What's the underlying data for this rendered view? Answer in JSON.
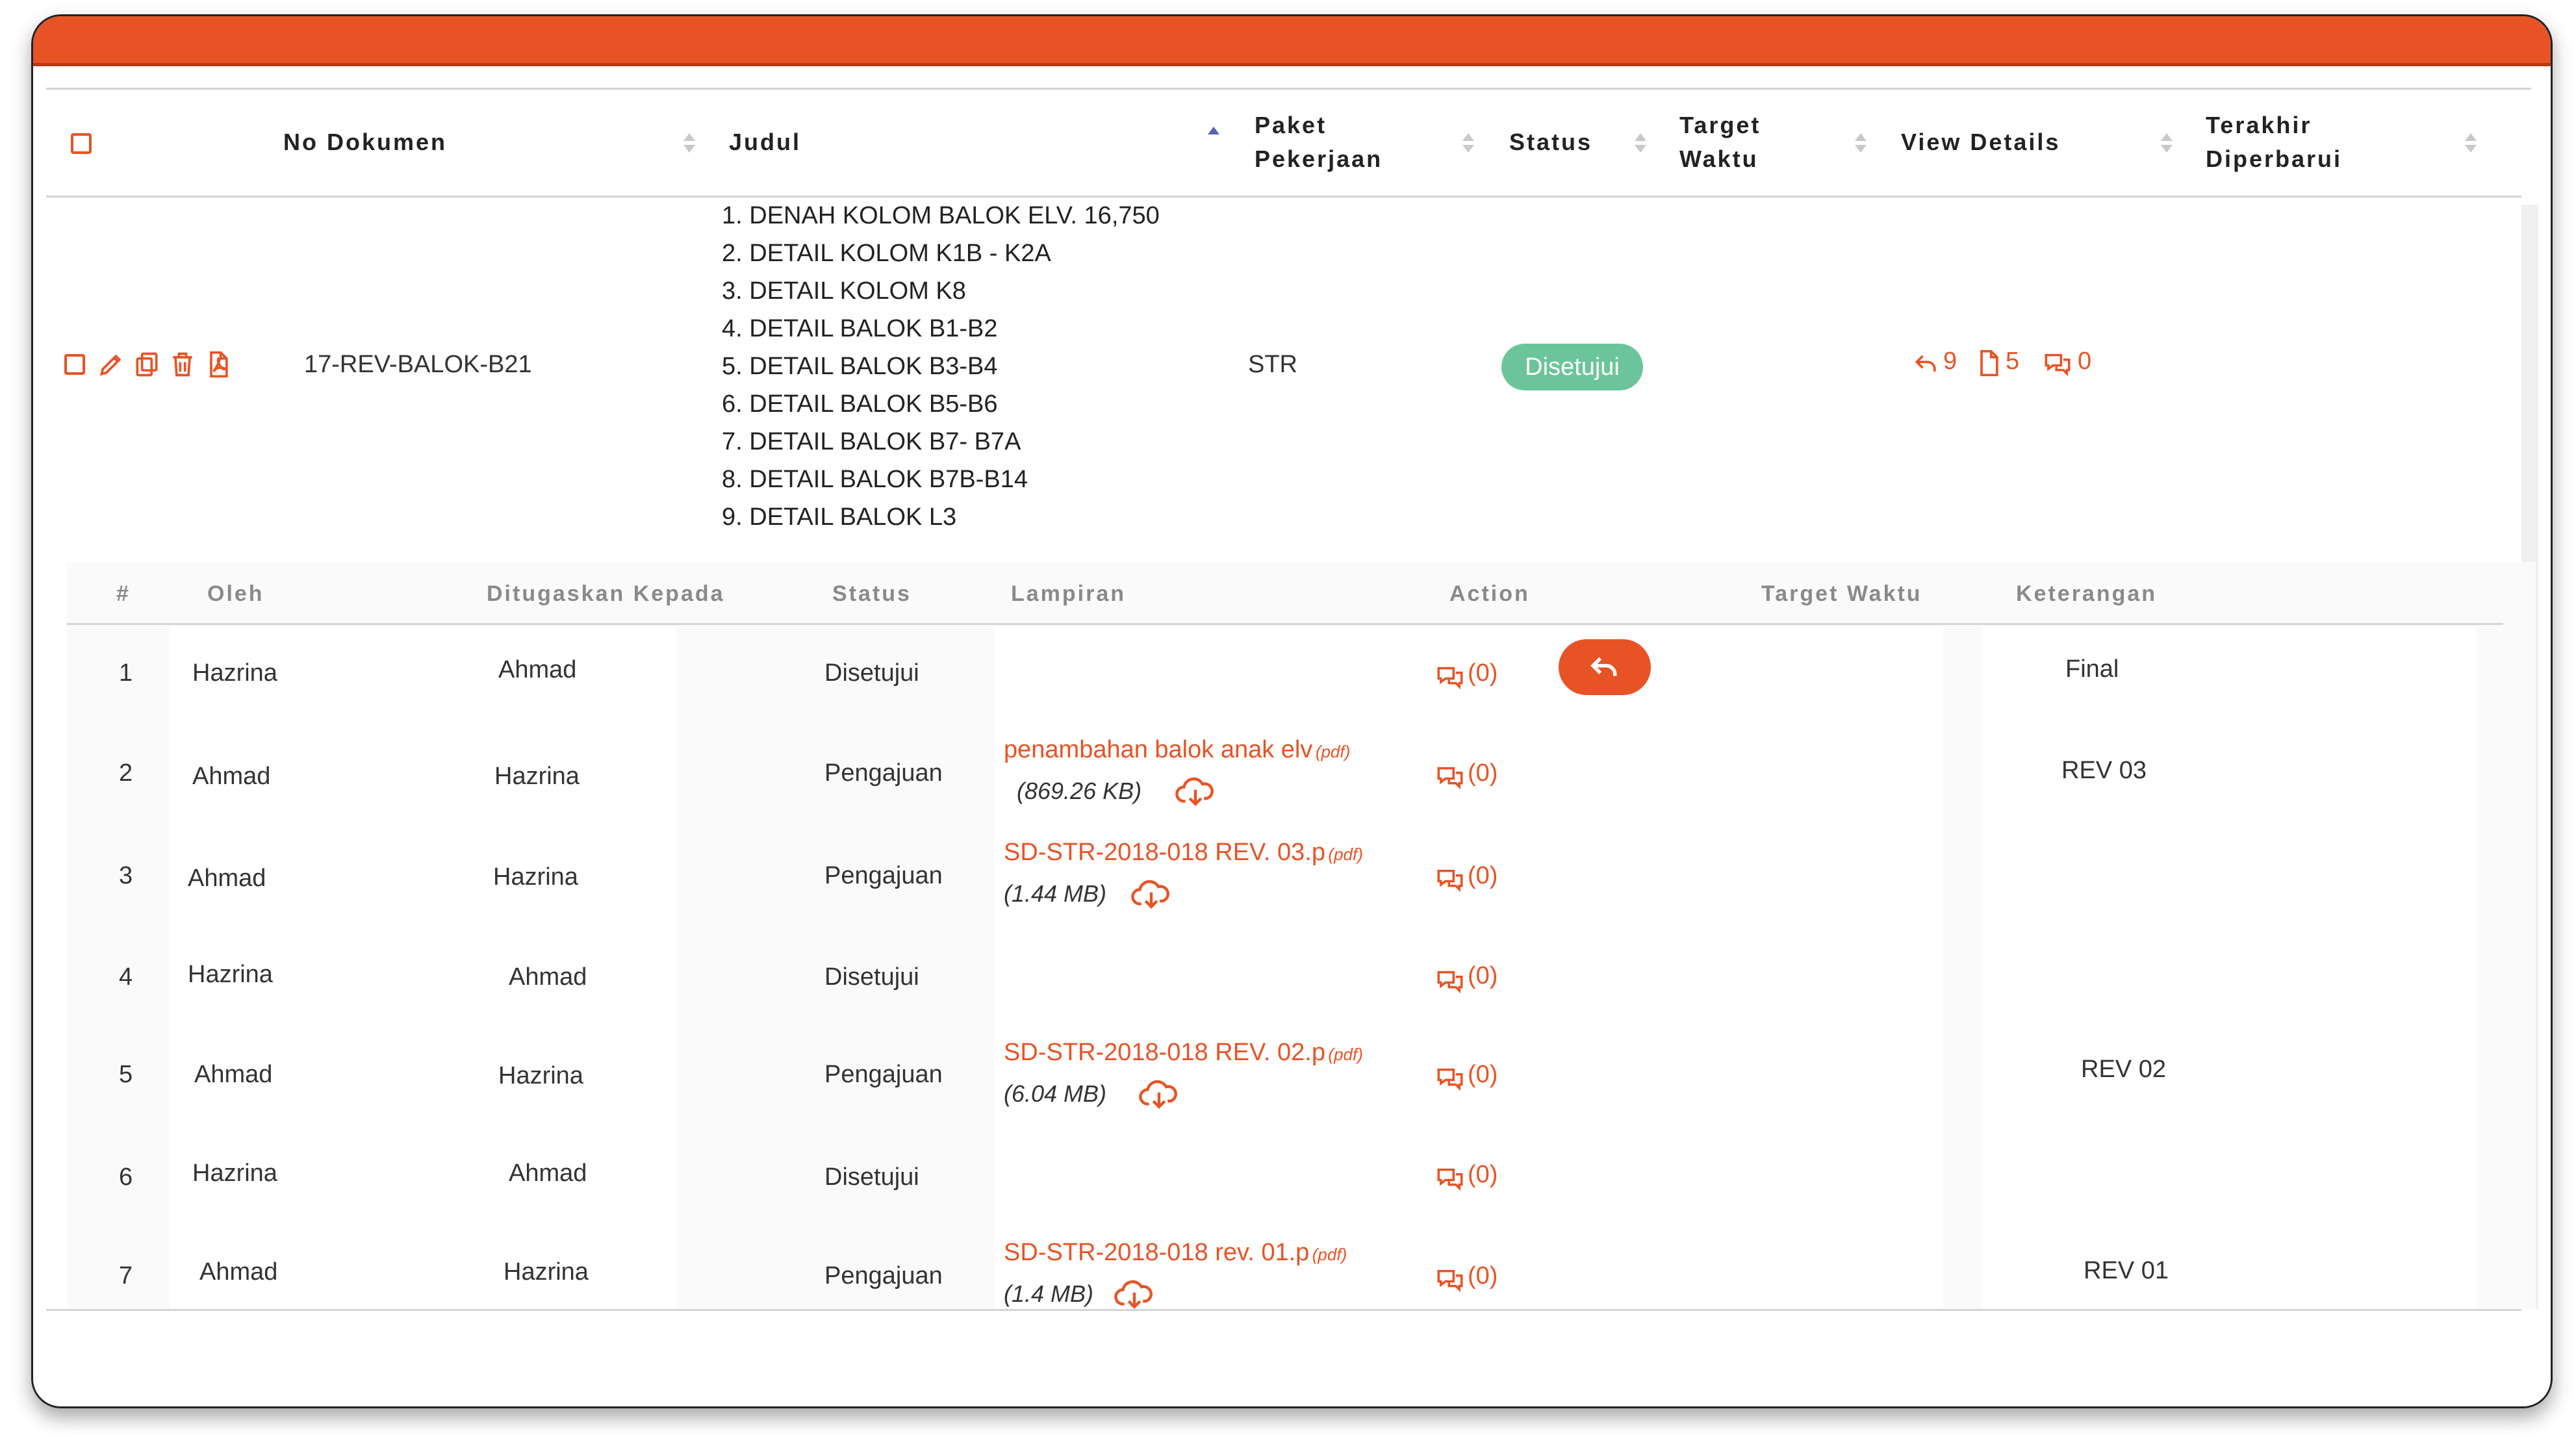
{
  "table": {
    "headers": {
      "no_dokumen": "No Dokumen",
      "judul": "Judul",
      "paket_line1": "Paket",
      "paket_line2": "Pekerjaan",
      "status": "Status",
      "target_line1": "Target",
      "target_line2": "Waktu",
      "view_details": "View Details",
      "terakhir_line1": "Terakhir",
      "terakhir_line2": "Diperbarui"
    },
    "row": {
      "no_dokumen": "17-REV-BALOK-B21",
      "judul": [
        "1. DENAH KOLOM BALOK ELV. 16,750",
        "2. DETAIL KOLOM K1B - K2A",
        "3. DETAIL KOLOM K8",
        "4. DETAIL BALOK B1-B2",
        "5. DETAIL BALOK B3-B4",
        "6. DETAIL BALOK B5-B6",
        "7. DETAIL BALOK B7- B7A",
        "8. DETAIL BALOK B7B-B14",
        "9. DETAIL BALOK L3"
      ],
      "paket": "STR",
      "status": "Disetujui",
      "details": {
        "replies": "9",
        "files": "5",
        "comments": "0"
      }
    }
  },
  "history": {
    "headers": {
      "num": "#",
      "oleh": "Oleh",
      "ditugaskan": "Ditugaskan Kepada",
      "status": "Status",
      "lampiran": "Lampiran",
      "action": "Action",
      "target": "Target Waktu",
      "keterangan": "Keterangan"
    },
    "rows": [
      {
        "num": "1",
        "oleh": "Hazrina",
        "kepada": "Ahmad",
        "status": "Disetujui",
        "file": "",
        "type": "",
        "size": "",
        "comments": "(0)",
        "ket": "Final"
      },
      {
        "num": "2",
        "oleh": "Ahmad",
        "kepada": "Hazrina",
        "status": "Pengajuan",
        "file": "penambahan balok anak elv",
        "type": "(pdf)",
        "size": "(869.26 KB)",
        "comments": "(0)",
        "ket": "REV 03"
      },
      {
        "num": "3",
        "oleh": "Ahmad",
        "kepada": "Hazrina",
        "status": "Pengajuan",
        "file": "SD-STR-2018-018 REV. 03.p",
        "type": "(pdf)",
        "size": "(1.44 MB)",
        "comments": "(0)",
        "ket": ""
      },
      {
        "num": "4",
        "oleh": "Hazrina",
        "kepada": "Ahmad",
        "status": "Disetujui",
        "file": "",
        "type": "",
        "size": "",
        "comments": "(0)",
        "ket": ""
      },
      {
        "num": "5",
        "oleh": "Ahmad",
        "kepada": "Hazrina",
        "status": "Pengajuan",
        "file": "SD-STR-2018-018 REV. 02.p",
        "type": "(pdf)",
        "size": "(6.04 MB)",
        "comments": "(0)",
        "ket": "REV 02"
      },
      {
        "num": "6",
        "oleh": "Hazrina",
        "kepada": "Ahmad",
        "status": "Disetujui",
        "file": "",
        "type": "",
        "size": "",
        "comments": "(0)",
        "ket": ""
      },
      {
        "num": "7",
        "oleh": "Ahmad",
        "kepada": "Hazrina",
        "status": "Pengajuan",
        "file": "SD-STR-2018-018 rev. 01.p",
        "type": "(pdf)",
        "size": "(1.4 MB)",
        "comments": "(0)",
        "ket": "REV 01"
      }
    ]
  },
  "colors": {
    "accent": "#e85325",
    "approved_badge": "#6cc59a",
    "sort_active": "#5563b5"
  }
}
